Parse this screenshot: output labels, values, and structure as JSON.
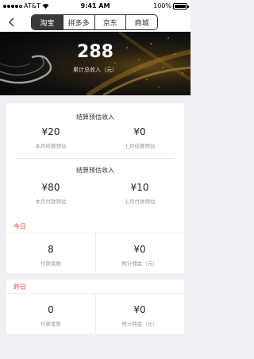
{
  "status_bar": {
    "carrier": "AT&T",
    "time": "9:41 AM",
    "battery": "100%"
  },
  "nav": {
    "tabs": [
      "淘宝",
      "拼多多",
      "京东",
      "商城"
    ],
    "active_tab": 0
  },
  "hero": {
    "total": "288",
    "total_label": "累计总收入（元）"
  },
  "settle": {
    "title": "结算预估收入",
    "this_month": {
      "value": "¥20",
      "label": "本月结算预估"
    },
    "last_month": {
      "value": "¥0",
      "label": "上月结算预估"
    }
  },
  "settle2": {
    "title": "结算预估收入",
    "this_month": {
      "value": "¥80",
      "label": "本月付款预估"
    },
    "last_month": {
      "value": "¥10",
      "label": "上月付款预估"
    }
  },
  "today": {
    "title": "今日",
    "orders": {
      "value": "8",
      "label": "付款笔数"
    },
    "commission": {
      "value": "¥0",
      "label": "预计佣金（元）"
    }
  },
  "yesterday": {
    "title": "昨日",
    "orders": {
      "value": "0",
      "label": "付款笔数"
    },
    "commission": {
      "value": "¥0",
      "label": "预计佣金（元）"
    }
  }
}
